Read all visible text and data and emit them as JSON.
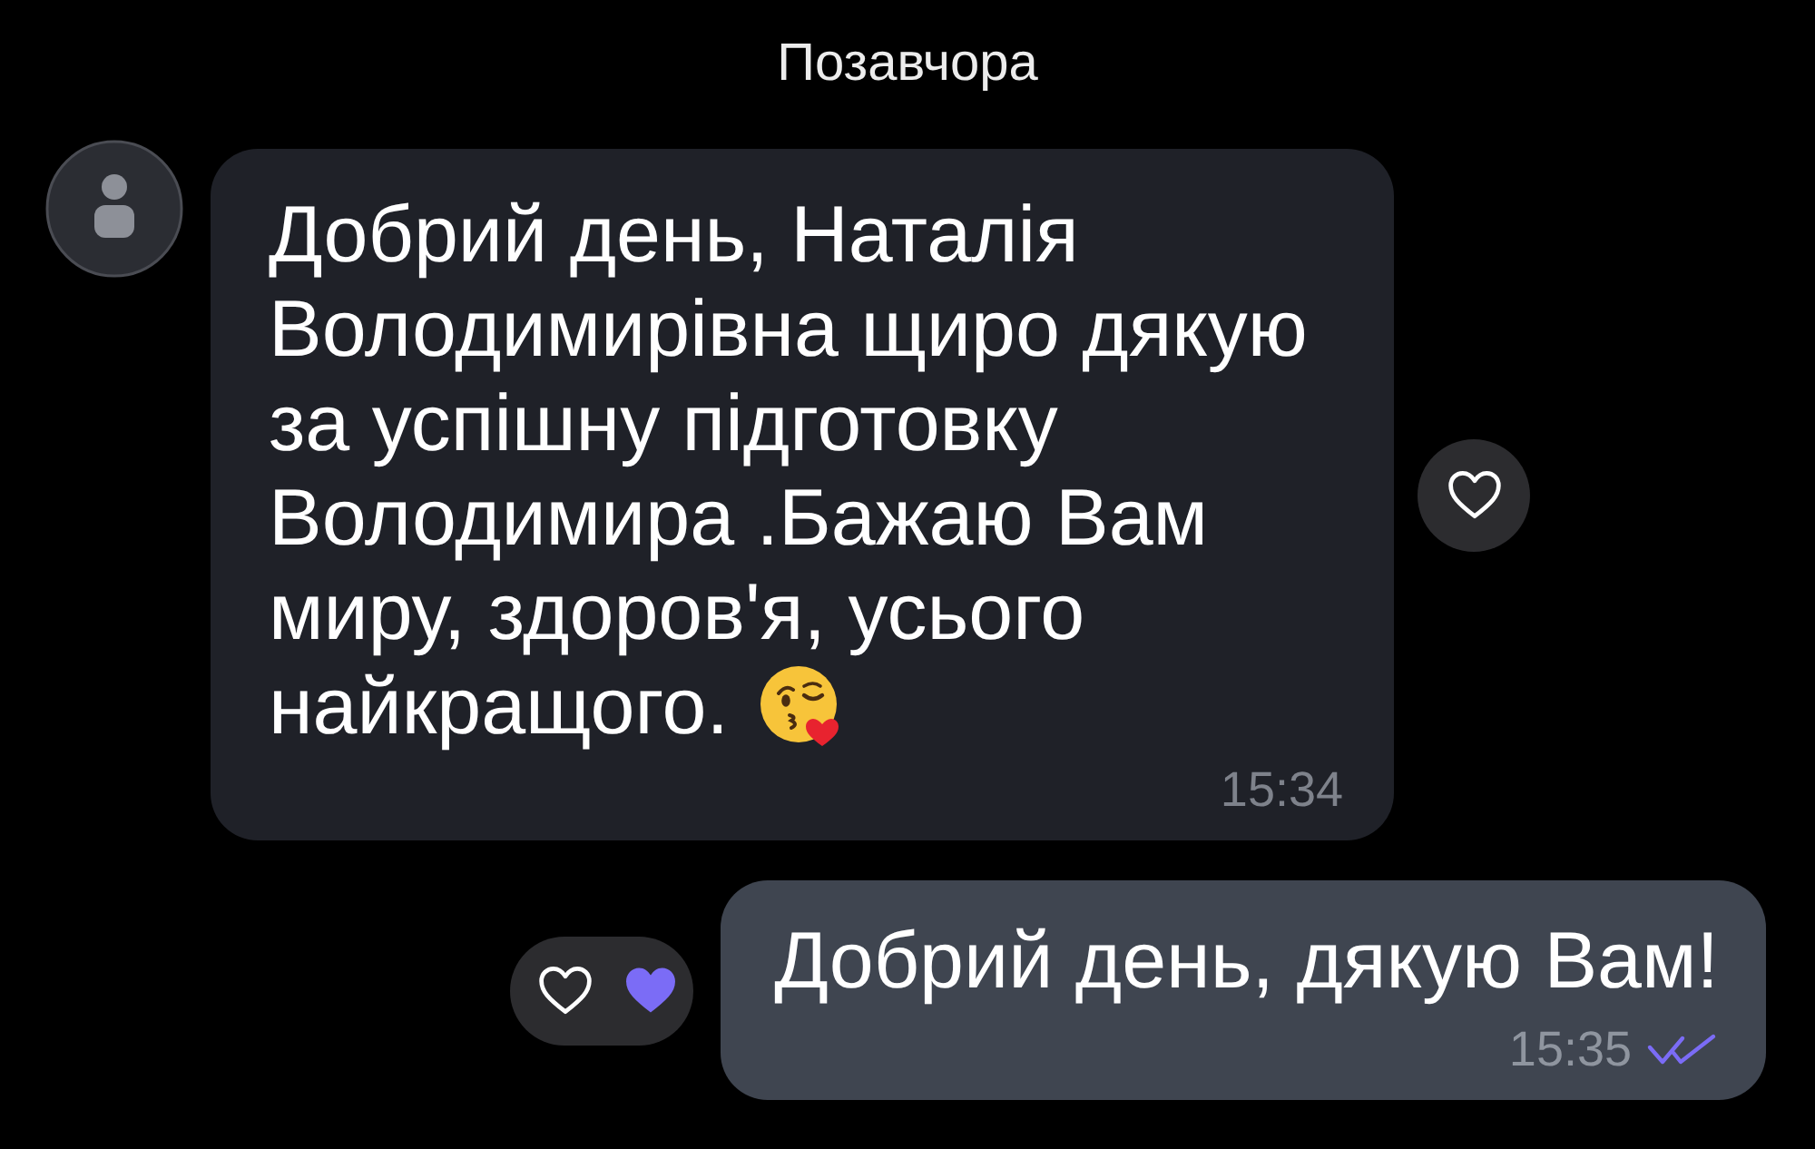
{
  "date_separator": "Позавчора",
  "messages": [
    {
      "kind": "incoming",
      "text": "Добрий день, Наталія Володимирівна щиро дякую за успішну підготовку Володимира .Бажаю Вам миру, здоров'я, усього найкращого.",
      "trailing_emoji": true,
      "time": "15:34",
      "liked": false
    },
    {
      "kind": "outgoing",
      "text": "Добрий день, дякую Вам!",
      "trailing_emoji": false,
      "time": "15:35",
      "liked": true,
      "read": true
    }
  ]
}
